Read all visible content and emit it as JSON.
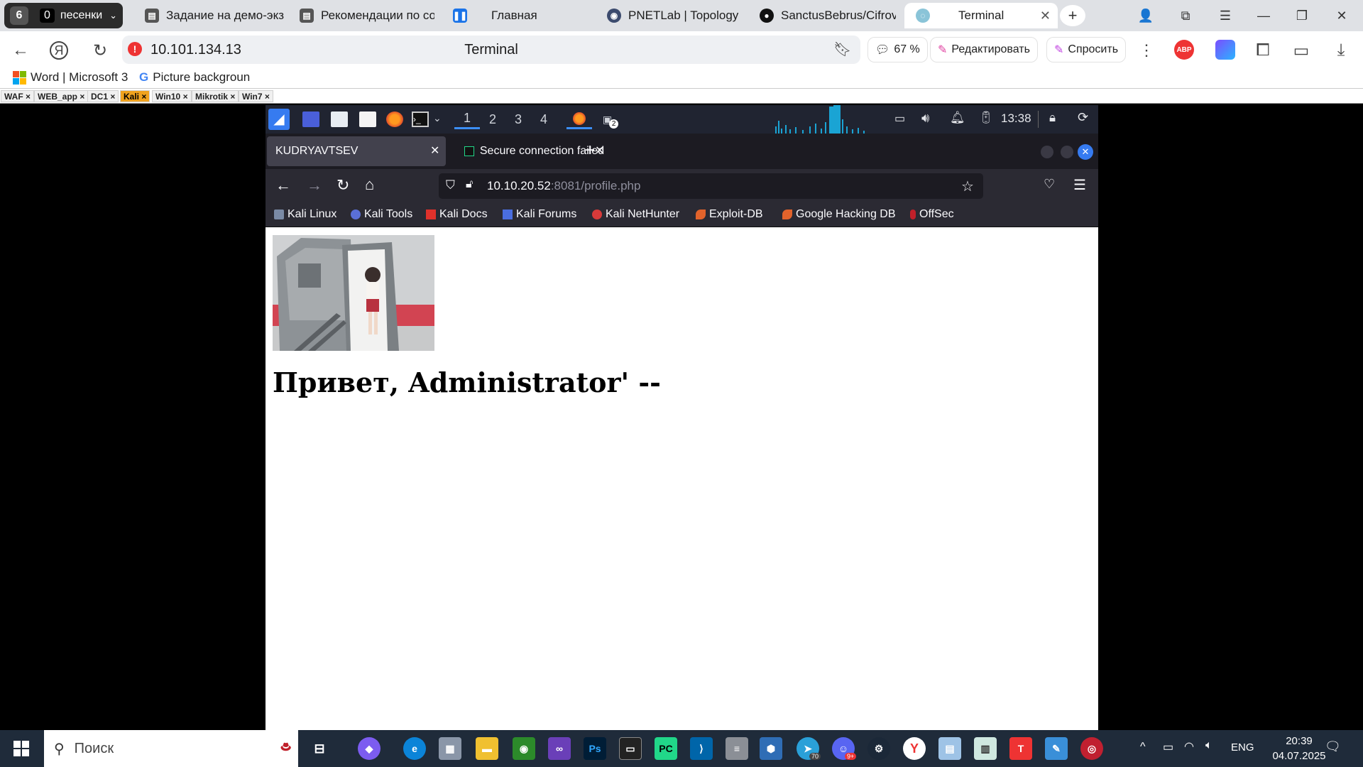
{
  "yandex": {
    "group": {
      "count": "6",
      "badge": "0",
      "name": "песенки"
    },
    "tabs": [
      {
        "label": "Задание на демо-экз",
        "icon": "document-icon"
      },
      {
        "label": "Рекомендации по со",
        "icon": "document-icon"
      },
      {
        "label": "Главная",
        "icon": "pause-icon"
      },
      {
        "label": "PNETLab | Topology",
        "icon": "pnetlab-icon"
      },
      {
        "label": "SanctusBebrus/Cifrov",
        "icon": "github-icon"
      },
      {
        "label": "Terminal",
        "icon": "terminal-icon"
      }
    ],
    "address": {
      "url": "10.101.134.13",
      "title": "Terminal"
    },
    "zoom": "67 %",
    "edit_label": "Редактировать",
    "ask_label": "Спросить",
    "adblock_label": "ABP",
    "bookmarks": [
      {
        "label": "Word | Microsoft 3"
      },
      {
        "label": "Picture backgroun"
      }
    ]
  },
  "pnetlab": {
    "node_tabs": [
      "WAF",
      "WEB_app",
      "DC1",
      "Kali",
      "Win10",
      "Mikrotik",
      "Win7"
    ],
    "selected": "Kali",
    "close_glyph": "×"
  },
  "kali": {
    "workspaces": [
      "1",
      "2",
      "3",
      "4"
    ],
    "clock": "13:38",
    "window_badge": "2"
  },
  "firefox": {
    "tabs": [
      {
        "label": "KUDRYAVTSEV"
      },
      {
        "label": "Secure connection failed a"
      }
    ],
    "url_host": "10.10.20.52",
    "url_rest": ":8081/profile.php",
    "bookmarks": [
      "Kali Linux",
      "Kali Tools",
      "Kali Docs",
      "Kali Forums",
      "Kali NetHunter",
      "Exploit-DB",
      "Google Hacking DB",
      "OffSec"
    ]
  },
  "page": {
    "greeting": "Привет, Administrator' --"
  },
  "taskbar": {
    "search_placeholder": "Поиск",
    "lang": "ENG",
    "time": "20:39",
    "date": "04.07.2025",
    "steam_badge": "70",
    "discord_badge": "9+"
  },
  "colors": {
    "kali_panel": "#202431",
    "firefox_dark": "#2b2a33",
    "node_tab_selected": "#f0a21e",
    "taskbar": "#1f2b3a"
  }
}
